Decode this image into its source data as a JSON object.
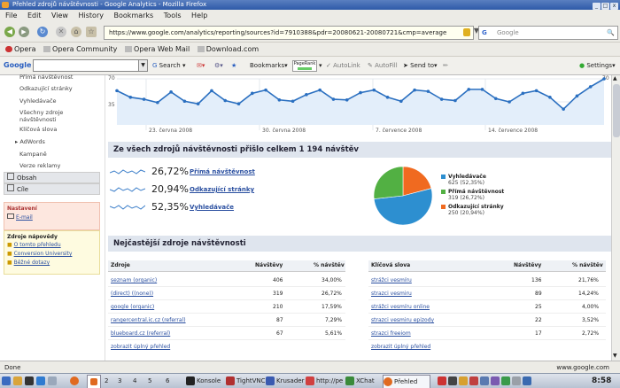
{
  "window": {
    "title": "Přehled zdrojů návštěvnosti - Google Analytics - Mozilla Firefox",
    "controls": [
      "_",
      "□",
      "x"
    ]
  },
  "menu": [
    "File",
    "Edit",
    "View",
    "History",
    "Bookmarks",
    "Tools",
    "Help"
  ],
  "nav": {
    "url": "https://www.google.com/analytics/reporting/sources?id=7910388&pdr=20080621-20080721&cmp=average",
    "search_placeholder": "Google"
  },
  "bookmarks": [
    "Opera",
    "Opera Community",
    "Opera Web Mail",
    "Download.com"
  ],
  "gtoolbar": {
    "logo": "Google",
    "search": "Search",
    "bookmarks": "Bookmarks",
    "pagerank": "PageRank",
    "autolink": "AutoLink",
    "autofill": "AutoFill",
    "sendto": "Send to",
    "settings": "Settings"
  },
  "sidebar": {
    "items": [
      "Přímá návštěvnost",
      "Odkazující stránky",
      "Vyhledávače",
      "Všechny zdroje návštěvnosti",
      "Klíčová slova",
      "AdWords",
      "Kampaně",
      "Verze reklamy"
    ],
    "sections": [
      "Obsah",
      "Cíle"
    ],
    "settings_title": "Nastavení",
    "settings_link": "E-mail",
    "help_title": "Zdroje nápovědy",
    "help_links": [
      "O tomto přehledu",
      "Conversion University",
      "Běžné dotazy"
    ]
  },
  "graph": {
    "y_labels": [
      "70",
      "35"
    ],
    "right_label": "70",
    "x_labels": [
      "23. června 2008",
      "30. června 2008",
      "7. července 2008",
      "14. července 2008"
    ]
  },
  "chart_data": {
    "type": "line",
    "title": "",
    "xlabel": "",
    "ylabel": "",
    "ylim": [
      0,
      70
    ],
    "values": [
      52,
      42,
      39,
      34,
      50,
      36,
      32,
      52,
      37,
      32,
      48,
      53,
      38,
      36,
      46,
      53,
      39,
      38,
      49,
      53,
      42,
      36,
      53,
      51,
      39,
      37,
      54,
      54,
      40,
      35,
      48,
      52,
      42,
      24,
      44,
      58,
      70
    ]
  },
  "summary": {
    "title": "Ze všech zdrojů návštěvnosti přišlo celkem 1 194 návštěv",
    "rows": [
      {
        "pct": "26,72%",
        "label": "Přímá návštěvnost"
      },
      {
        "pct": "20,94%",
        "label": "Odkazující stránky"
      },
      {
        "pct": "52,35%",
        "label": "Vyhledávače"
      }
    ]
  },
  "pie": {
    "legend": [
      {
        "name": "Vyhledávače",
        "detail": "625 (52,35%)",
        "color": "#2d8fd0",
        "value": 52.35
      },
      {
        "name": "Přímá návštěvnost",
        "detail": "319 (26,72%)",
        "color": "#52b043",
        "value": 26.72
      },
      {
        "name": "Odkazující stránky",
        "detail": "250 (20,94%)",
        "color": "#f06a20",
        "value": 20.94
      }
    ]
  },
  "top_sources": {
    "title": "Nejčastější zdroje návštěvnosti",
    "left_headers": [
      "Zdroje",
      "Návštěvy",
      "% návštěv"
    ],
    "left_rows": [
      [
        "seznam (organic)",
        "406",
        "34,00%"
      ],
      [
        "(direct) ((none))",
        "319",
        "26,72%"
      ],
      [
        "google (organic)",
        "210",
        "17,59%"
      ],
      [
        "rangercentral.ic.cz (referral)",
        "87",
        "7,29%"
      ],
      [
        "blueboard.cz (referral)",
        "67",
        "5,61%"
      ]
    ],
    "left_more": "zobrazit úplný přehled",
    "right_headers": [
      "Klíčová slova",
      "Návštěvy",
      "% návštěv"
    ],
    "right_rows": [
      [
        "strážci vesmíru",
        "136",
        "21,76%"
      ],
      [
        "strazci vesmiru",
        "89",
        "14,24%"
      ],
      [
        "strážci vesmíru online",
        "25",
        "4,00%"
      ],
      [
        "strazci vesmiru epizody",
        "22",
        "3,52%"
      ],
      [
        "strazci freeiom",
        "17",
        "2,72%"
      ]
    ],
    "right_more": "zobrazit úplný přehled"
  },
  "status": {
    "left": "Done",
    "right": "www.google.com"
  },
  "taskbar": {
    "desktops": [
      "2",
      "3",
      "4",
      "5",
      "6"
    ],
    "apps": [
      "Konsole",
      "TightVNC",
      "Krusader",
      "http://pe",
      "XChat",
      "Přehled"
    ],
    "clock": "8:58"
  }
}
